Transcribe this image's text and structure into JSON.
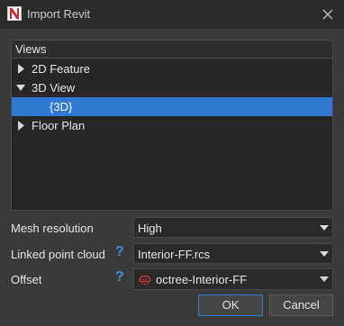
{
  "window": {
    "title": "Import Revit",
    "icons": [
      "app-n-logo-icon",
      "close-icon"
    ],
    "brand_color": "#e0202a"
  },
  "tree": {
    "header": "Views",
    "items": [
      {
        "label": "2D Feature",
        "expanded": false
      },
      {
        "label": "3D View",
        "expanded": true
      },
      {
        "label": "{3D}",
        "selected": true
      },
      {
        "label": "Floor Plan",
        "expanded": false
      }
    ],
    "selection_color": "#2f78d4"
  },
  "form": {
    "mesh_resolution": {
      "label": "Mesh resolution",
      "value": "High"
    },
    "linked_point_cloud": {
      "label": "Linked point cloud",
      "help": "?",
      "value": "Interior-FF.rcs"
    },
    "offset": {
      "label": "Offset",
      "help": "?",
      "value": "octree-Interior-FF",
      "icon": "point-cloud-icon"
    }
  },
  "buttons": {
    "ok": "OK",
    "cancel": "Cancel"
  }
}
